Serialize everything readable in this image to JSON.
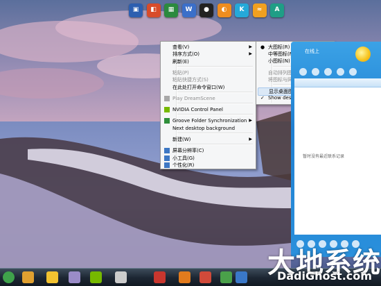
{
  "top_dock": {
    "icons": [
      {
        "name": "computer-icon",
        "color": "#2c5fb0",
        "glyph": "▣"
      },
      {
        "name": "presentation-icon",
        "color": "#d84c2a",
        "glyph": "◧"
      },
      {
        "name": "spreadsheet-icon",
        "color": "#2b8a3e",
        "glyph": "▦"
      },
      {
        "name": "word-icon",
        "color": "#3b6fc9",
        "glyph": "W"
      },
      {
        "name": "qq-penguin-icon",
        "color": "#222222",
        "glyph": "●"
      },
      {
        "name": "orange-app-icon",
        "color": "#ef8d1f",
        "glyph": "◐"
      },
      {
        "name": "k-app-icon",
        "color": "#25a9d9",
        "glyph": "K"
      },
      {
        "name": "swirl-app-icon",
        "color": "#f0a020",
        "glyph": "≈"
      },
      {
        "name": "a-app-icon",
        "color": "#1f9e86",
        "glyph": "A"
      }
    ]
  },
  "context_menu": {
    "items": [
      {
        "label": "查看(V)",
        "submenu": true
      },
      {
        "label": "排序方式(O)",
        "submenu": true
      },
      {
        "label": "刷新(E)"
      },
      {
        "sep": true
      },
      {
        "label": "粘贴(P)",
        "disabled": true
      },
      {
        "label": "粘贴快捷方式(S)",
        "disabled": true
      },
      {
        "label": "在此处打开命令窗口(W)"
      },
      {
        "sep": true
      },
      {
        "label": "Play DreamScene",
        "disabled": true,
        "icon": "#a8a8a8"
      },
      {
        "sep": true
      },
      {
        "label": "NVIDIA Control Panel",
        "icon": "#76b900"
      },
      {
        "sep": true
      },
      {
        "label": "Groove Folder Synchronization",
        "submenu": true,
        "icon": "#2f8f3a"
      },
      {
        "label": "Next desktop background"
      },
      {
        "sep": true
      },
      {
        "label": "新建(W)",
        "submenu": true
      },
      {
        "sep": true
      },
      {
        "label": "屏幕分辨率(C)",
        "icon": "#3d77c4"
      },
      {
        "label": "小工具(G)",
        "icon": "#3d77c4"
      },
      {
        "label": "个性化(R)",
        "icon": "#3d77c4"
      }
    ]
  },
  "view_submenu": {
    "items": [
      {
        "label": "大图标(R)",
        "mark": "●"
      },
      {
        "label": "中等图标(M)"
      },
      {
        "label": "小图标(N)"
      },
      {
        "sep": true
      },
      {
        "label": "自动排列图标(A)",
        "disabled": true
      },
      {
        "label": "将图标与网格对齐(I)",
        "disabled": true
      },
      {
        "sep": true
      },
      {
        "label": "显示桌面图标(D)",
        "highlight": true
      },
      {
        "label": "Show desktop gadgets",
        "mark": "✓"
      }
    ]
  },
  "qq_panel": {
    "status": "在线上",
    "empty_text": "暂时没有最近联系记录"
  },
  "taskbar": {
    "icons": [
      {
        "name": "start-orb-icon",
        "color": "#3fa24b"
      },
      {
        "name": "media-player-icon",
        "color": "#e0a030"
      },
      {
        "name": "qq-taskbar-icon",
        "color": "#f2c230"
      },
      {
        "name": "window-icon",
        "color": "#9a8cc8"
      },
      {
        "name": "nvidia-taskbar-icon",
        "color": "#76b900"
      },
      {
        "name": "globe-icon",
        "color": "#cccccc"
      },
      {
        "name": "red-app-icon",
        "color": "#c8362e"
      },
      {
        "name": "orange-taskbar-icon",
        "color": "#e27b1d"
      },
      {
        "name": "red-app2-icon",
        "color": "#d04a3a"
      },
      {
        "name": "green-app-icon",
        "color": "#4aa04a"
      },
      {
        "name": "blue-app-icon",
        "color": "#3a78c8"
      }
    ]
  },
  "watermark": {
    "cn": "大地系统",
    "en": "DadiGhost.com"
  }
}
